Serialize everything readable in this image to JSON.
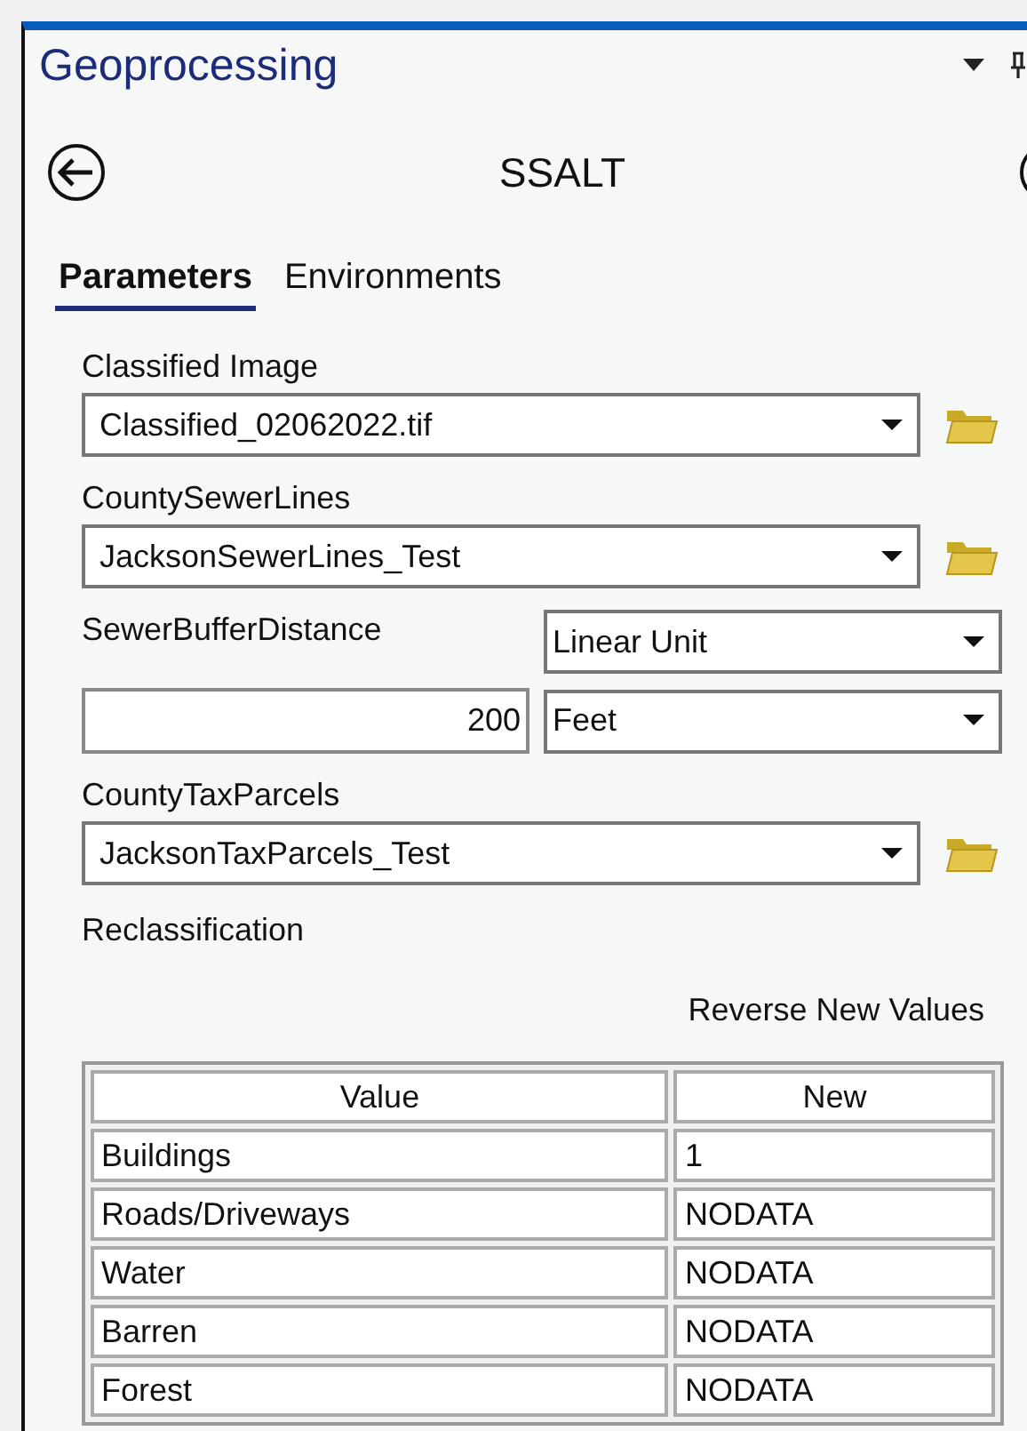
{
  "pane": {
    "title": "Geoprocessing"
  },
  "tool": {
    "name": "SSALT"
  },
  "tabs": [
    {
      "label": "Parameters",
      "selected": true
    },
    {
      "label": "Environments",
      "selected": false
    }
  ],
  "parameters": [
    {
      "kind": "dataset",
      "label": "Classified Image",
      "value": "Classified_02062022.tif"
    },
    {
      "kind": "dataset",
      "label": "CountySewerLines",
      "value": "JacksonSewerLines_Test"
    },
    {
      "kind": "linear_unit",
      "label": "SewerBufferDistance",
      "type": "Linear Unit",
      "value": "200",
      "unit": "Feet"
    },
    {
      "kind": "dataset",
      "label": "CountyTaxParcels",
      "value": "JacksonTaxParcels_Test"
    }
  ],
  "reclassification": {
    "label": "Reclassification",
    "reverse_button": "Reverse New Values",
    "columns": [
      "Value",
      "New"
    ],
    "rows": [
      [
        "Buildings",
        "1"
      ],
      [
        "Roads/Driveways",
        "NODATA"
      ],
      [
        "Water",
        "NODATA"
      ],
      [
        "Barren",
        "NODATA"
      ],
      [
        "Forest",
        "NODATA"
      ]
    ]
  }
}
